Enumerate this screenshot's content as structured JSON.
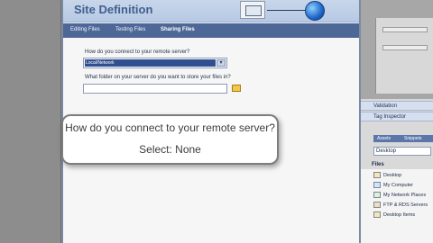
{
  "dialog": {
    "title": "Site Definition",
    "tabs": [
      {
        "label": "Editing Files",
        "active": false
      },
      {
        "label": "Testing Files",
        "active": false
      },
      {
        "label": "Sharing Files",
        "active": true
      }
    ],
    "question1": "How do you connect to your remote server?",
    "connection_select": {
      "value": "Local/Network",
      "button_glyph": "▾"
    },
    "question2": "What folder on your server do you want to store your files in?",
    "folder_input": {
      "value": ""
    }
  },
  "right_panel": {
    "section1": "Validation",
    "section2": "Tag Inspector",
    "tabs": [
      "Assets",
      "Snippets"
    ],
    "location_select": "Desktop",
    "files_header": "Files",
    "files": [
      {
        "label": "Desktop",
        "icon": "desktop-icon"
      },
      {
        "label": "My Computer",
        "icon": "computer-icon"
      },
      {
        "label": "My Network Places",
        "icon": "network-icon"
      },
      {
        "label": "FTP & RDS Servers",
        "icon": "ftp-icon"
      },
      {
        "label": "Desktop Items",
        "icon": "folder-icon"
      }
    ]
  },
  "callout": {
    "question": "How do you connect to your remote server?",
    "answer": "Select: None"
  },
  "colors": {
    "header_bg": "#c8d6ea",
    "tab_bar": "#4d6797",
    "selection": "#2f4f90"
  }
}
